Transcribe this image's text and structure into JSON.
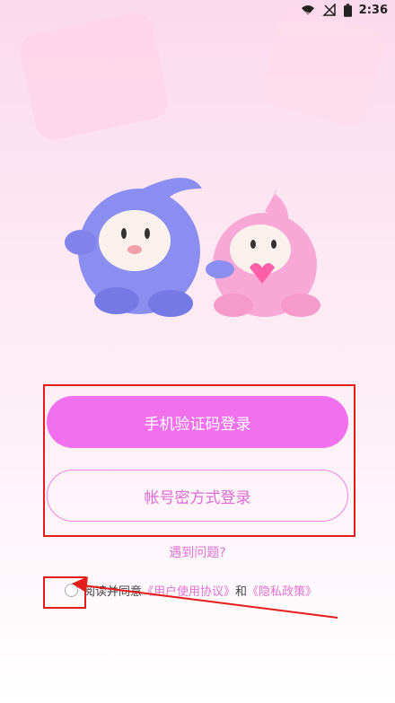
{
  "status_bar": {
    "time": "2:36",
    "icons": [
      "wifi-icon",
      "signal-off-icon",
      "battery-icon"
    ]
  },
  "login": {
    "primary_button": "手机验证码登录",
    "secondary_button": "帐号密方式登录",
    "help_link": "遇到问题?"
  },
  "agreement": {
    "prefix": "阅读并同意",
    "user_agreement": "《用户使用协议》",
    "conjunction": "和",
    "privacy_policy": "《隐私政策》",
    "checked": false
  },
  "colors": {
    "accent": "#f270ee",
    "link": "#e571d8",
    "annotation": "#e31c1c"
  }
}
